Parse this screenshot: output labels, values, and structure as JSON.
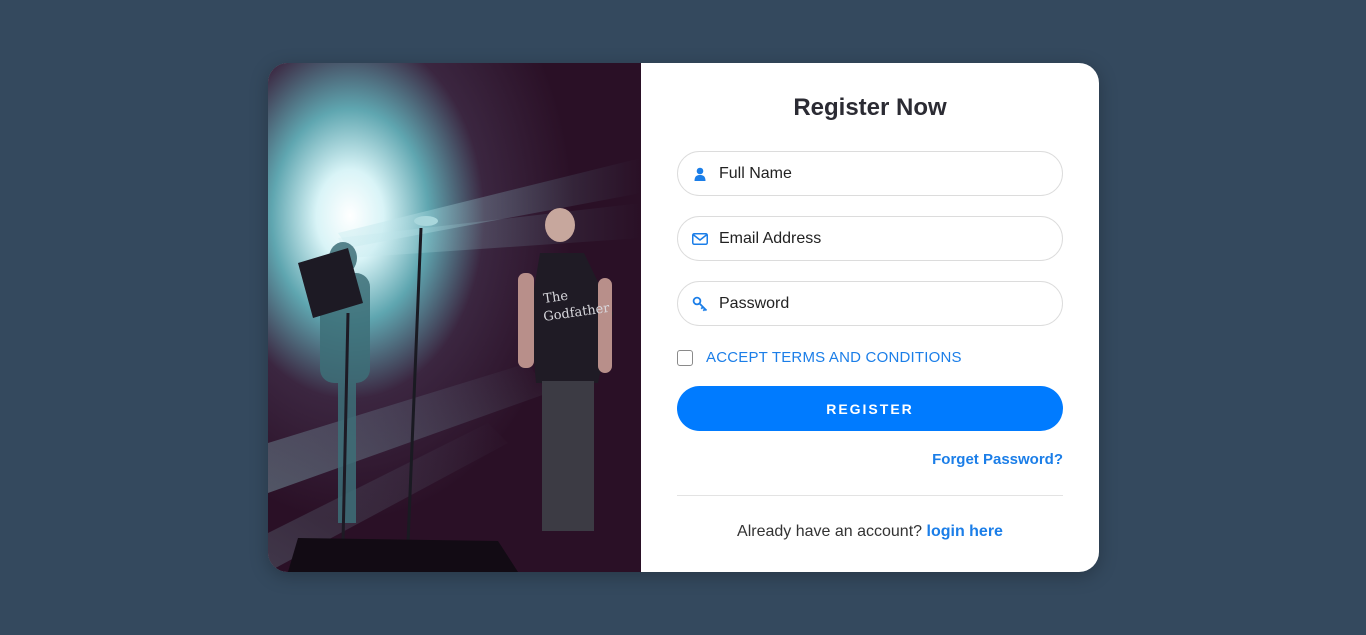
{
  "form": {
    "title": "Register Now",
    "fields": {
      "full_name": {
        "placeholder": "Full Name",
        "icon": "user-icon"
      },
      "email": {
        "placeholder": "Email Address",
        "icon": "envelope-icon"
      },
      "password": {
        "placeholder": "Password",
        "icon": "key-icon"
      }
    },
    "terms_label": "ACCEPT TERMS AND CONDITIONS",
    "register_label": "REGISTER",
    "forget_password": "Forget Password?",
    "already_text": "Already have an account?",
    "login_link": "login here"
  },
  "colors": {
    "background": "#34495e",
    "accent": "#007bff",
    "link": "#1b7ee8"
  }
}
